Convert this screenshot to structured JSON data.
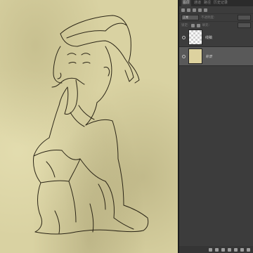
{
  "panel": {
    "tabs": [
      "图层",
      "通道",
      "路径",
      "历史记录"
    ],
    "blend_mode": "正常",
    "opacity_label": "不透明度:",
    "lock_label": "锁定:",
    "fill_label": "填充:"
  },
  "layers": [
    {
      "name": "线稿",
      "selected": false,
      "thumb": "transparent"
    },
    {
      "name": "背景",
      "selected": true,
      "thumb": "paper"
    }
  ],
  "icons": {
    "eye": "eye-icon",
    "link": "link-icon",
    "fx": "fx-icon",
    "mask": "mask-icon",
    "adjust": "adjustment-icon",
    "group": "folder-icon",
    "new": "new-layer-icon",
    "trash": "trash-icon"
  }
}
